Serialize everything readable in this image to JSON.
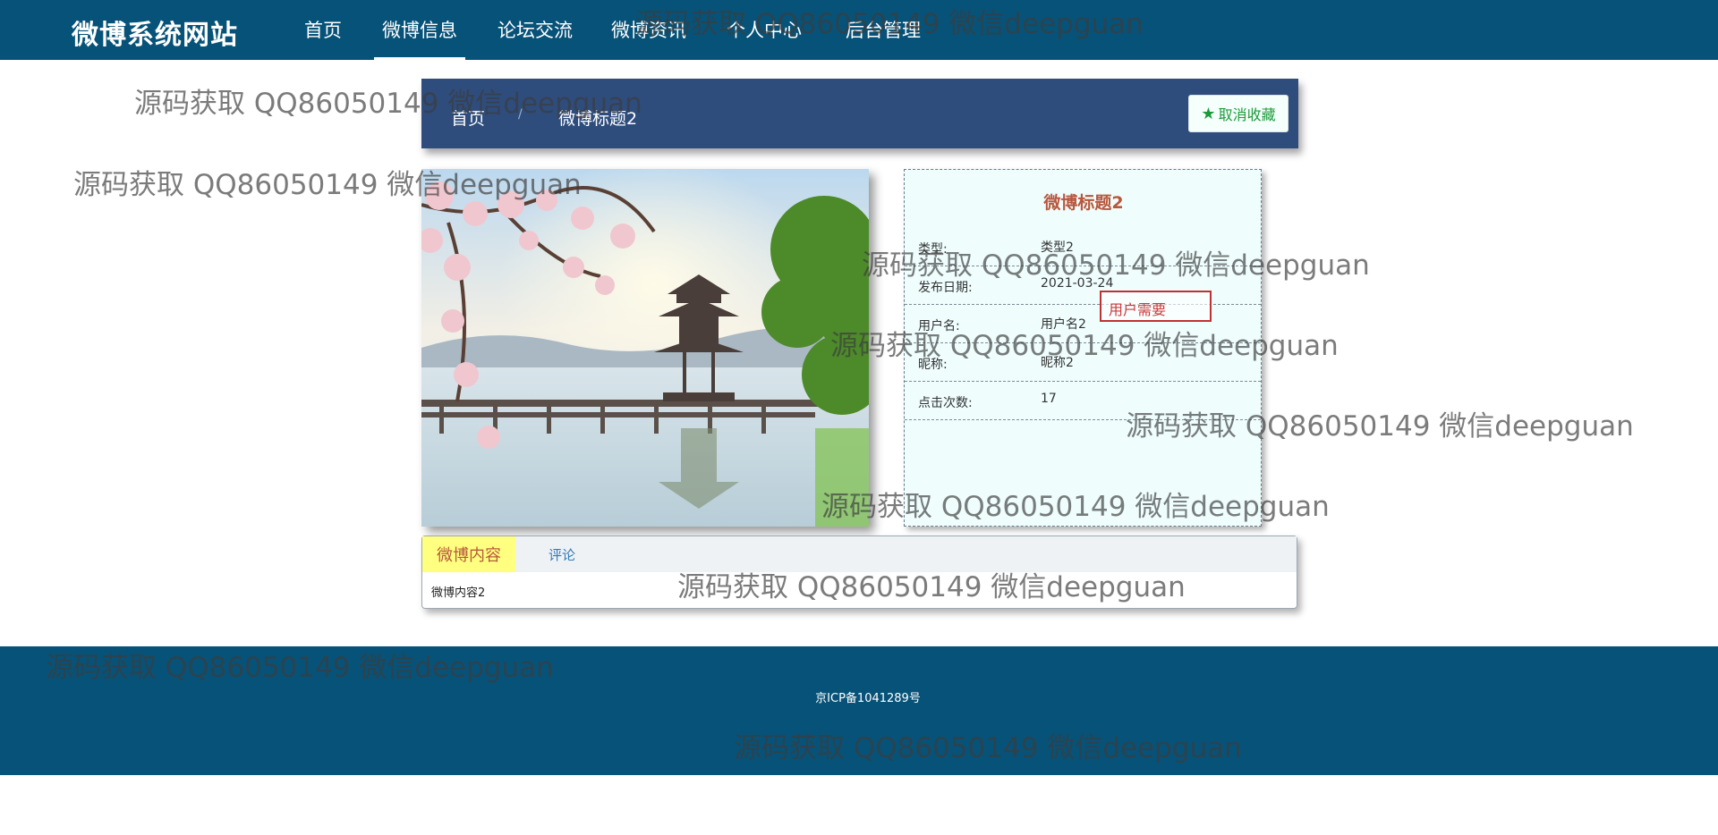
{
  "nav": {
    "brand": "微博系统网站",
    "items": [
      "首页",
      "微博信息",
      "论坛交流",
      "微博资讯",
      "个人中心",
      "后台管理"
    ],
    "active_index": 1
  },
  "breadcrumb": {
    "home": "首页",
    "separator": "/",
    "current": "微博标题2"
  },
  "favorite_button": "取消收藏",
  "detail": {
    "title": "微博标题2",
    "rows": [
      {
        "label": "类型:",
        "value": "类型2"
      },
      {
        "label": "发布日期:",
        "value": "2021-03-24"
      },
      {
        "label": "用户名:",
        "value": "用户名2"
      },
      {
        "label": "昵称:",
        "value": "昵称2"
      },
      {
        "label": "点击次数:",
        "value": "17"
      }
    ]
  },
  "need_box": "用户需要",
  "tabs": {
    "content_tab": "微博内容",
    "comment_tab": "评论",
    "content_text": "微博内容2"
  },
  "footer": {
    "icp": "京ICP备1041289号"
  },
  "watermark": "源码获取 QQ86050149 微信deepguan",
  "colors": {
    "nav_bg": "#075278",
    "crumb_bg": "#2e4d7d",
    "title_color": "#b9573c",
    "tab_active_bg": "#ffff80",
    "favorite_green": "#1c9a3a"
  }
}
